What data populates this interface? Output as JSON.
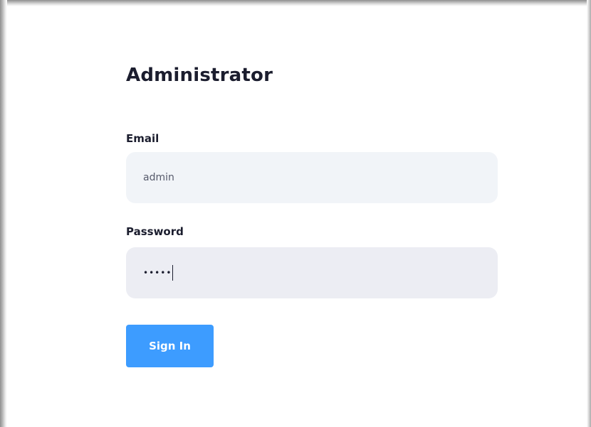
{
  "login": {
    "title": "Administrator",
    "email_label": "Email",
    "email_value": "admin",
    "password_label": "Password",
    "password_display": "•••••",
    "signin_label": "Sign In"
  },
  "colors": {
    "accent": "#3d9cff",
    "text": "#1b1d2e",
    "field_background": "#f1f4f8"
  }
}
